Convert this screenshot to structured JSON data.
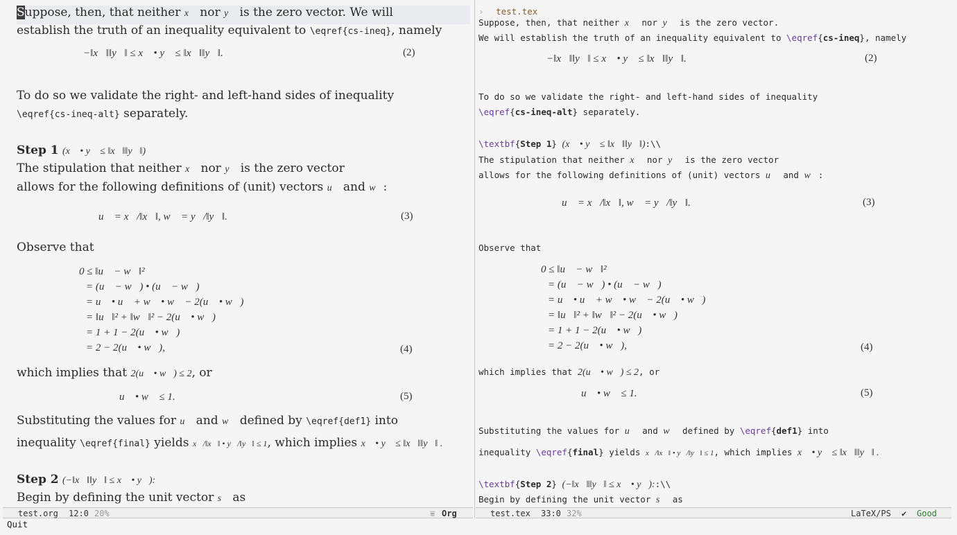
{
  "left": {
    "p1a": "Suppose, then, that neither",
    "p1a_cursor_char": "S",
    "p1a_rest": "uppose, then, that neither",
    "x_vec": "x⃗",
    "nor": "nor",
    "y_vec": "y⃗",
    "p1b": "is the zero vector. We will",
    "p2a": "establish the truth of an inequality equivalent to",
    "eqref_cs_ineq": "\\eqref{cs-ineq}",
    "p2b": ", namely",
    "eq2": "−‖x⃗‖‖y⃗‖ ≤ x⃗ • y⃗ ≤ ‖x⃗‖‖y⃗‖.",
    "eq2_num": "(2)",
    "p3": "To do so we validate the right- and left-hand sides of inequality",
    "eqref_cs_ineq_alt": "\\eqref{cs-ineq-alt}",
    "p4": "separately.",
    "step1": "Step 1",
    "step1_math": "(x⃗ • y⃗ ≤ ‖x⃗‖‖y⃗‖)",
    "p5a": "The stipulation that neither",
    "p5b": "is the zero vector",
    "p6a": "allows for the following definitions of (unit) vectors",
    "u_vec": "u⃗",
    "and": "and",
    "w_vec": "w⃗",
    "colon": ":",
    "eq3": "u⃗ = x⃗/‖x⃗‖,  w⃗ = y⃗/‖y⃗‖.",
    "eq3_num": "(3)",
    "observe": "Observe that",
    "eq4_lines": [
      "0 ≤ ‖u⃗ − w⃗‖²",
      "= (u⃗ − w⃗) • (u⃗ − w⃗)",
      "= u⃗ • u⃗ + w⃗ • w⃗ − 2(u⃗ • w⃗)",
      "= ‖u⃗‖² + ‖w⃗‖² − 2(u⃗ • w⃗)",
      "= 1 + 1 − 2(u⃗ • w⃗)",
      "= 2 − 2(u⃗ • w⃗),"
    ],
    "eq4_num": "(4)",
    "implies": "which implies that",
    "implies_math": "2(u⃗ • w⃗) ≤ 2",
    "or": ", or",
    "eq5": "u⃗ • w⃗ ≤ 1.",
    "eq5_num": "(5)",
    "sub1": "Substituting the values for",
    "defined_by": "defined by",
    "eqref_def1": "\\eqref{def1}",
    "into": "into",
    "sub2a": "inequality",
    "eqref_final": "\\eqref{final}",
    "yields": "yields",
    "yields_math": "x⃗/‖x⃗‖ • y⃗/‖y⃗‖ ≤ 1",
    "which_implies": ", which implies",
    "which_implies_math": "x⃗ • y⃗ ≤ ‖x⃗‖‖y⃗‖ .",
    "step2": "Step 2",
    "step2_math": "(−‖x⃗‖‖y⃗‖ ≤ x⃗ • y⃗):",
    "begin": "Begin by defining the unit vector",
    "s_vec": "s⃗",
    "as": "as"
  },
  "right": {
    "filename": "test.tex",
    "l1": "Suppose, then, that neither",
    "l1b": "is the zero vector.",
    "l2a": "We will establish the truth of an inequality equivalent to",
    "eqref_kw": "\\eqref",
    "cs_ineq": "cs-ineq",
    "l2b": ", namely",
    "l3": "To do so we validate the right- and left-hand sides of inequality",
    "cs_ineq_alt": "cs-ineq-alt",
    "separately": "separately.",
    "textbf_kw": "\\textbf",
    "step1": "Step 1",
    "step1_tail": ":\\\\",
    "l5": "The stipulation that neither",
    "l5b": "is the zero vector",
    "l6": "allows for the following definitions of (unit) vectors",
    "observe": "Observe that",
    "implies": "which implies that",
    "or": ", or",
    "sub1": "Substituting the values for",
    "def1": "def1",
    "sub2": "inequality",
    "final": "final",
    "yields": "yields",
    "which_implies": ", which implies",
    "step2": "Step 2",
    "step2_tail": ":\\\\",
    "begin": "Begin by defining the unit vector"
  },
  "modeline_left": {
    "buffer": "test.org",
    "position": "12:0",
    "percent": "20%",
    "mode_icon": "⩸",
    "mode": "Org"
  },
  "modeline_right": {
    "buffer": "test.tex",
    "position": "33:0",
    "percent": "32%",
    "mode": "LaTeX/PS",
    "status_icon": "✔",
    "status": "Good"
  },
  "minibuffer": "Quit"
}
